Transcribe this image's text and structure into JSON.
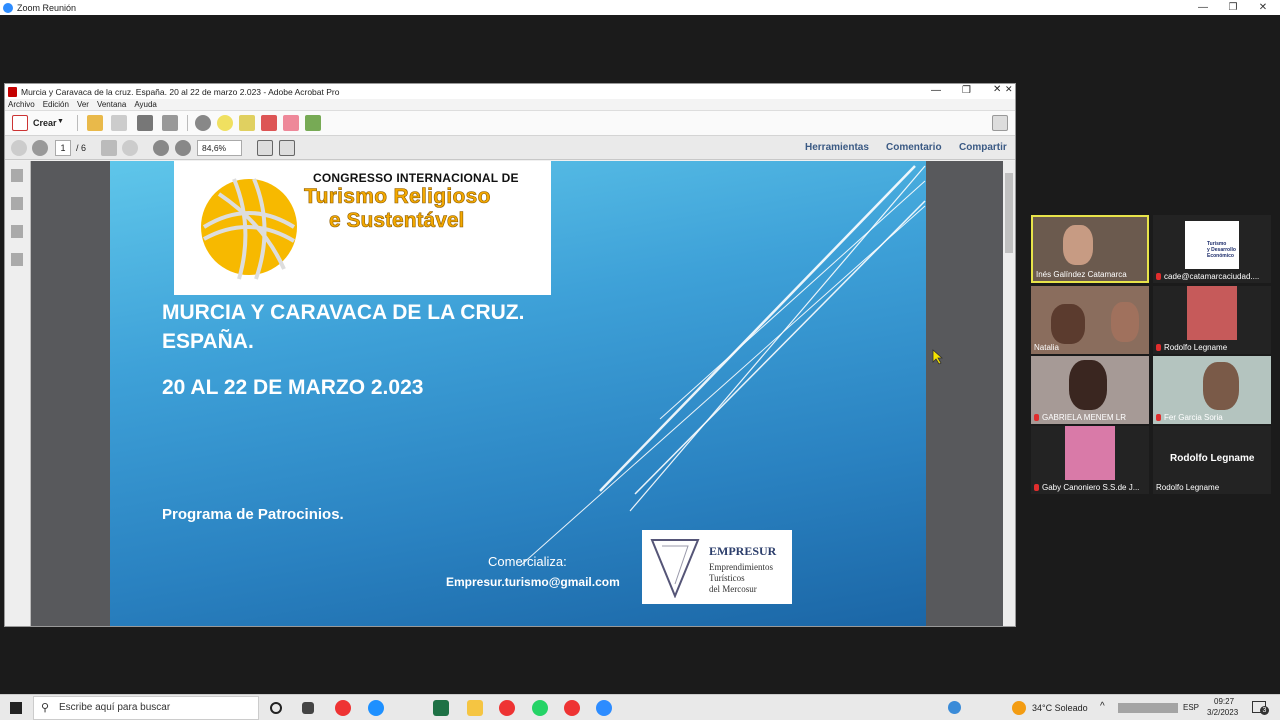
{
  "zoom": {
    "title": "Zoom Reunión"
  },
  "acrobat": {
    "title": "Murcia y Caravaca de la cruz. España. 20 al 22 de marzo 2.023 - Adobe Acrobat Pro",
    "menu": [
      "Archivo",
      "Edición",
      "Ver",
      "Ventana",
      "Ayuda"
    ],
    "create_label": "Crear",
    "page_current": "1",
    "page_total": "/ 6",
    "zoom_level": "84,6%",
    "right_links": [
      "Herramientas",
      "Comentario",
      "Compartir"
    ]
  },
  "slide": {
    "logo_line1": "CONGRESSO INTERNACIONAL DE",
    "logo_line2": "Turismo Religioso",
    "logo_line3": "e Sustentável",
    "heading_line1": "MURCIA Y CARAVACA DE LA CRUZ.",
    "heading_line2": "ESPAÑA.",
    "dates": "20 AL 22 DE MARZO 2.023",
    "program": "Programa de Patrocinios.",
    "comercializa": "Comercializa:",
    "email": "Empresur.turismo@gmail.com",
    "empresur_name": "EMPRESUR",
    "empresur_sub1": "Emprendimientos",
    "empresur_sub2": "Turísticos",
    "empresur_sub3": "del Mercosur"
  },
  "participants": [
    {
      "name": "Inés Galíndez  Catamarca",
      "muted": false
    },
    {
      "name": "cade@catamarcaciudad....",
      "muted": true,
      "logo_lines": [
        "Turismo",
        "y Desarrollo",
        "Económico"
      ]
    },
    {
      "name": "Natalia",
      "muted": false
    },
    {
      "name": "Rodolfo Legname",
      "muted": true
    },
    {
      "name": "GABRIELA MENEM LR",
      "muted": true
    },
    {
      "name": "Fer Garcia Soria",
      "muted": true
    },
    {
      "name": "Gaby Canoniero S.S.de J...",
      "muted": true
    },
    {
      "name": "Rodolfo Legname",
      "muted": false,
      "big_name": "Rodolfo Legname"
    }
  ],
  "taskbar": {
    "search_placeholder": "Escribe aquí para buscar",
    "weather": "34°C  Soleado",
    "lang": "ESP",
    "time": "09:27",
    "date": "3/2/2023",
    "notif_count": "3"
  }
}
